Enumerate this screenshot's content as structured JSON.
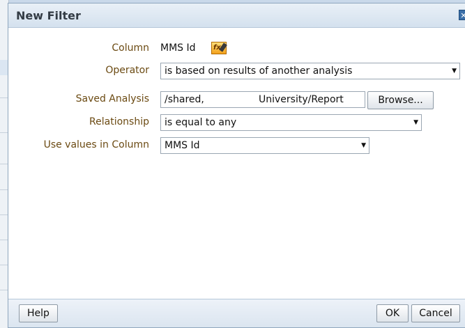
{
  "dialog": {
    "title": "New Filter",
    "close_glyph": "✕"
  },
  "form": {
    "column": {
      "label": "Column",
      "value": "MMS Id"
    },
    "operator": {
      "label": "Operator",
      "value": "is based on results of another analysis"
    },
    "saved_analysis": {
      "label": "Saved Analysis",
      "path_part1": "/shared,",
      "path_part2": "University/Report",
      "browse_label": "Browse..."
    },
    "relationship": {
      "label": "Relationship",
      "value": "is equal to any"
    },
    "use_values": {
      "label": "Use values in Column",
      "value": "MMS Id"
    }
  },
  "footer": {
    "help_label": "Help",
    "ok_label": "OK",
    "cancel_label": "Cancel"
  },
  "icons": {
    "edit_formula": "edit-formula-icon",
    "dropdown": "chevron-down-icon"
  }
}
